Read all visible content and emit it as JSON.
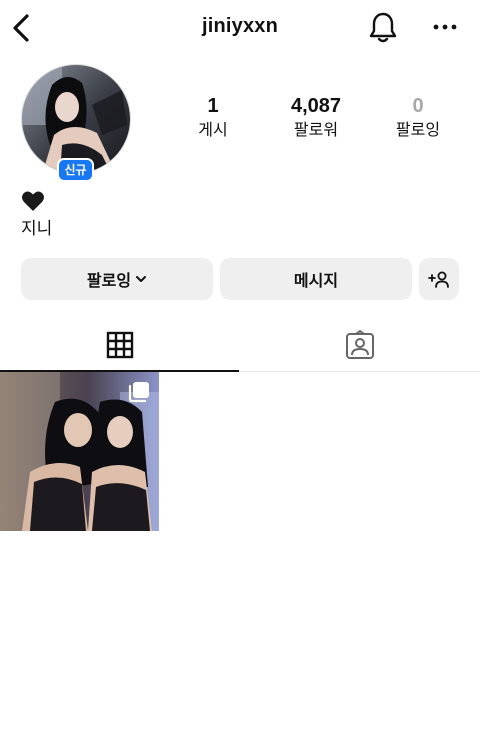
{
  "header": {
    "username": "jiniyxxn",
    "back_icon": "chevron-left-icon",
    "bell_icon": "bell-icon",
    "more_icon": "more-horizontal-icon"
  },
  "profile": {
    "badge": "신규",
    "stats": [
      {
        "value": "1",
        "label": "게시"
      },
      {
        "value": "4,087",
        "label": "팔로워"
      },
      {
        "value": "0",
        "label": "팔로잉"
      }
    ],
    "bio_emoji": "black-heart-icon",
    "bio_name": "지니"
  },
  "actions": {
    "following_label": "팔로잉",
    "message_label": "메시지",
    "add_person_icon": "add-person-icon"
  },
  "tabs": [
    {
      "icon": "grid-icon",
      "active": true
    },
    {
      "icon": "tagged-person-icon",
      "active": false
    }
  ],
  "posts": [
    {
      "type": "carousel",
      "icon": "multiple-posts-icon"
    }
  ],
  "colors": {
    "badge": "#1877f2",
    "button_bg": "#efefef",
    "muted": "#a8a8a8"
  }
}
